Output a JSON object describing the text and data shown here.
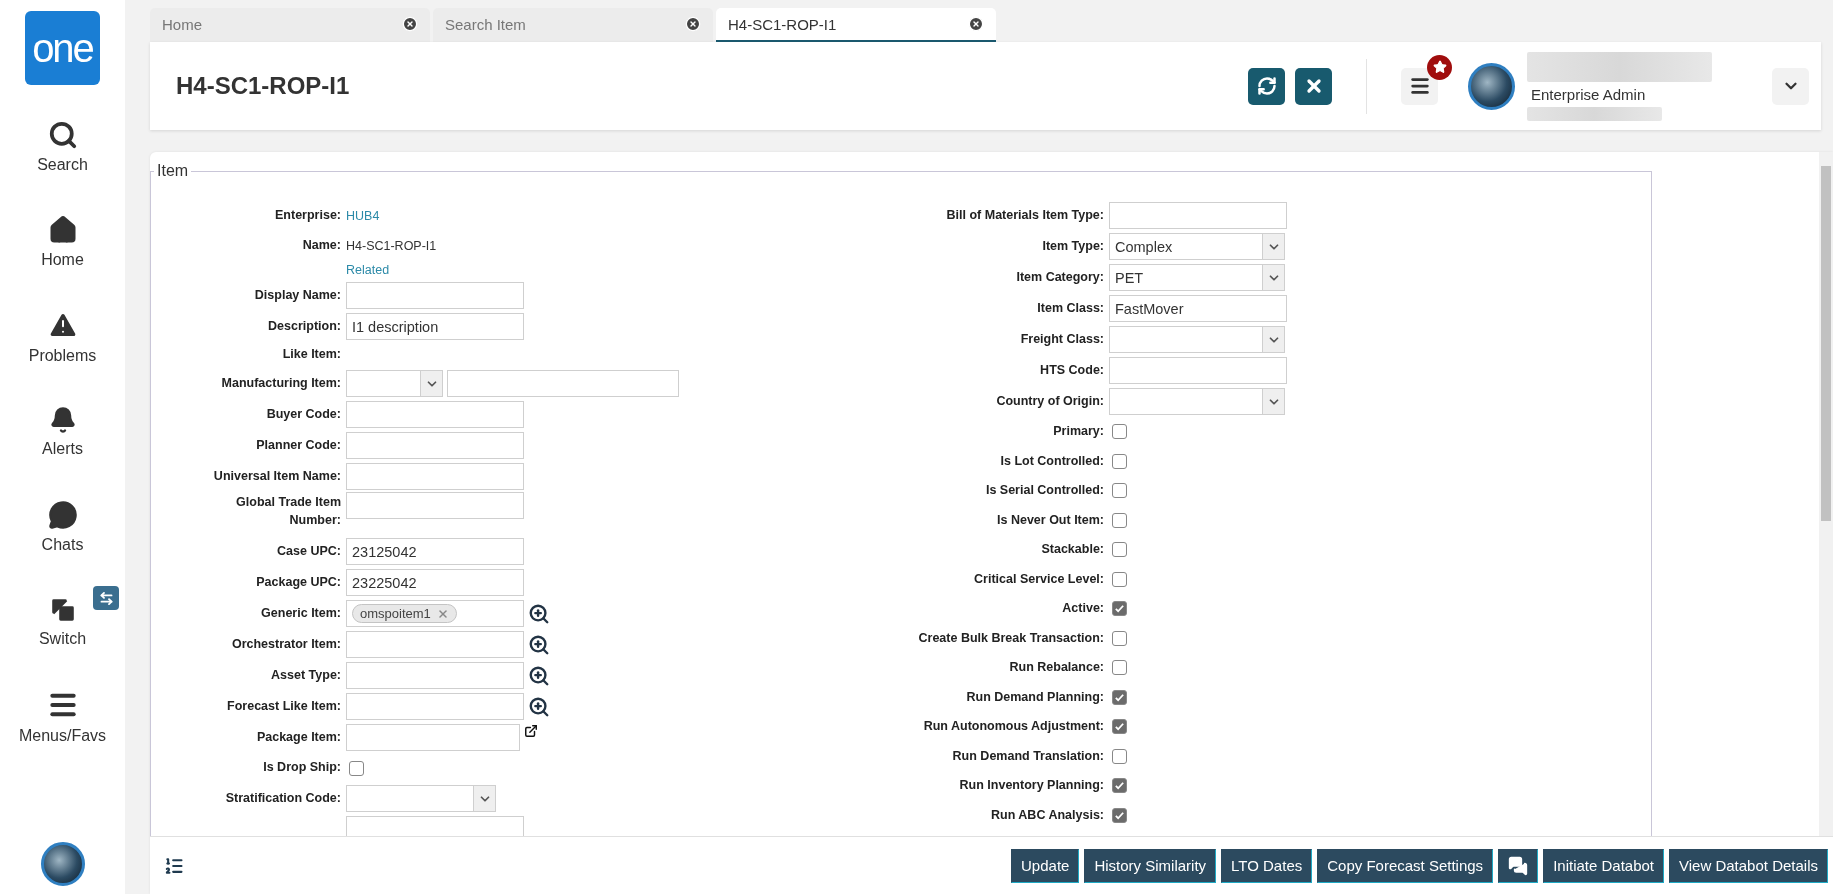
{
  "sidebar": {
    "logo": "one",
    "items": [
      {
        "kind": "search",
        "label": "Search"
      },
      {
        "kind": "home",
        "label": "Home"
      },
      {
        "kind": "problems",
        "label": "Problems"
      },
      {
        "kind": "alerts",
        "label": "Alerts"
      },
      {
        "kind": "chats",
        "label": "Chats"
      },
      {
        "kind": "switch",
        "label": "Switch"
      },
      {
        "kind": "menus",
        "label": "Menus/Favs"
      }
    ]
  },
  "tabs": [
    {
      "label": "Home",
      "selected": false
    },
    {
      "label": "Search Item",
      "selected": false
    },
    {
      "label": "H4-SC1-ROP-I1",
      "selected": true
    }
  ],
  "header": {
    "title": "H4-SC1-ROP-I1",
    "user_role": "Enterprise Admin"
  },
  "form": {
    "legend": "Item",
    "left_fields": [
      {
        "kind": "link",
        "label": "Enterprise:",
        "value": "HUB4"
      },
      {
        "kind": "text",
        "label": "Name:",
        "value": "H4-SC1-ROP-I1"
      },
      {
        "kind": "sublink",
        "value": "Related"
      },
      {
        "kind": "input",
        "label": "Display Name:"
      },
      {
        "kind": "input",
        "label": "Description:",
        "value": "I1 description"
      },
      {
        "kind": "text",
        "label": "Like Item:"
      },
      {
        "kind": "select_input",
        "label": "Manufacturing Item:"
      },
      {
        "kind": "input",
        "label": "Buyer Code:"
      },
      {
        "kind": "input",
        "label": "Planner Code:"
      },
      {
        "kind": "input",
        "label": "Universal Item Name:"
      },
      {
        "kind": "input",
        "label": "Global Trade Item Number:"
      },
      {
        "kind": "input",
        "label": "Case UPC:",
        "value": "23125042"
      },
      {
        "kind": "input",
        "label": "Package UPC:",
        "value": "23225042"
      },
      {
        "kind": "lookup",
        "label": "Generic Item:",
        "chip": "omspoitem1"
      },
      {
        "kind": "lookup",
        "label": "Orchestrator Item:"
      },
      {
        "kind": "lookup",
        "label": "Asset Type:"
      },
      {
        "kind": "lookup",
        "label": "Forecast Like Item:"
      },
      {
        "kind": "popout",
        "label": "Package Item:"
      },
      {
        "kind": "checkbox",
        "label": "Is Drop Ship:",
        "checked": false
      },
      {
        "kind": "select",
        "label": "Stratification Code:"
      },
      {
        "kind": "input"
      }
    ],
    "right_fields": [
      {
        "kind": "input",
        "label": "Bill of Materials Item Type:"
      },
      {
        "kind": "select",
        "label": "Item Type:",
        "value": "Complex"
      },
      {
        "kind": "select",
        "label": "Item Category:",
        "value": "PET"
      },
      {
        "kind": "input",
        "label": "Item Class:",
        "value": "FastMover"
      },
      {
        "kind": "select",
        "label": "Freight Class:"
      },
      {
        "kind": "input",
        "label": "HTS Code:"
      },
      {
        "kind": "select",
        "label": "Country of Origin:"
      },
      {
        "kind": "checkbox",
        "label": "Primary:",
        "checked": false
      },
      {
        "kind": "checkbox",
        "label": "Is Lot Controlled:",
        "checked": false
      },
      {
        "kind": "checkbox",
        "label": "Is Serial Controlled:",
        "checked": false
      },
      {
        "kind": "checkbox",
        "label": "Is Never Out Item:",
        "checked": false
      },
      {
        "kind": "checkbox",
        "label": "Stackable:",
        "checked": false
      },
      {
        "kind": "checkbox",
        "label": "Critical Service Level:",
        "checked": false
      },
      {
        "kind": "checkbox",
        "label": "Active:",
        "checked": true
      },
      {
        "kind": "checkbox",
        "label": "Create Bulk Break Transaction:",
        "checked": false
      },
      {
        "kind": "checkbox",
        "label": "Run Rebalance:",
        "checked": false
      },
      {
        "kind": "checkbox",
        "label": "Run Demand Planning:",
        "checked": true
      },
      {
        "kind": "checkbox",
        "label": "Run Autonomous Adjustment:",
        "checked": true
      },
      {
        "kind": "checkbox",
        "label": "Run Demand Translation:",
        "checked": false
      },
      {
        "kind": "checkbox",
        "label": "Run Inventory Planning:",
        "checked": true
      },
      {
        "kind": "checkbox",
        "label": "Run ABC Analysis:",
        "checked": true
      }
    ]
  },
  "actions": [
    {
      "kind": "text",
      "label": "Update"
    },
    {
      "kind": "text",
      "label": "History Similarity"
    },
    {
      "kind": "text",
      "label": "LTO Dates"
    },
    {
      "kind": "text",
      "label": "Copy Forecast Settings"
    },
    {
      "kind": "chat"
    },
    {
      "kind": "text",
      "label": "Initiate Databot"
    },
    {
      "kind": "text",
      "label": "View Databot Details"
    }
  ]
}
